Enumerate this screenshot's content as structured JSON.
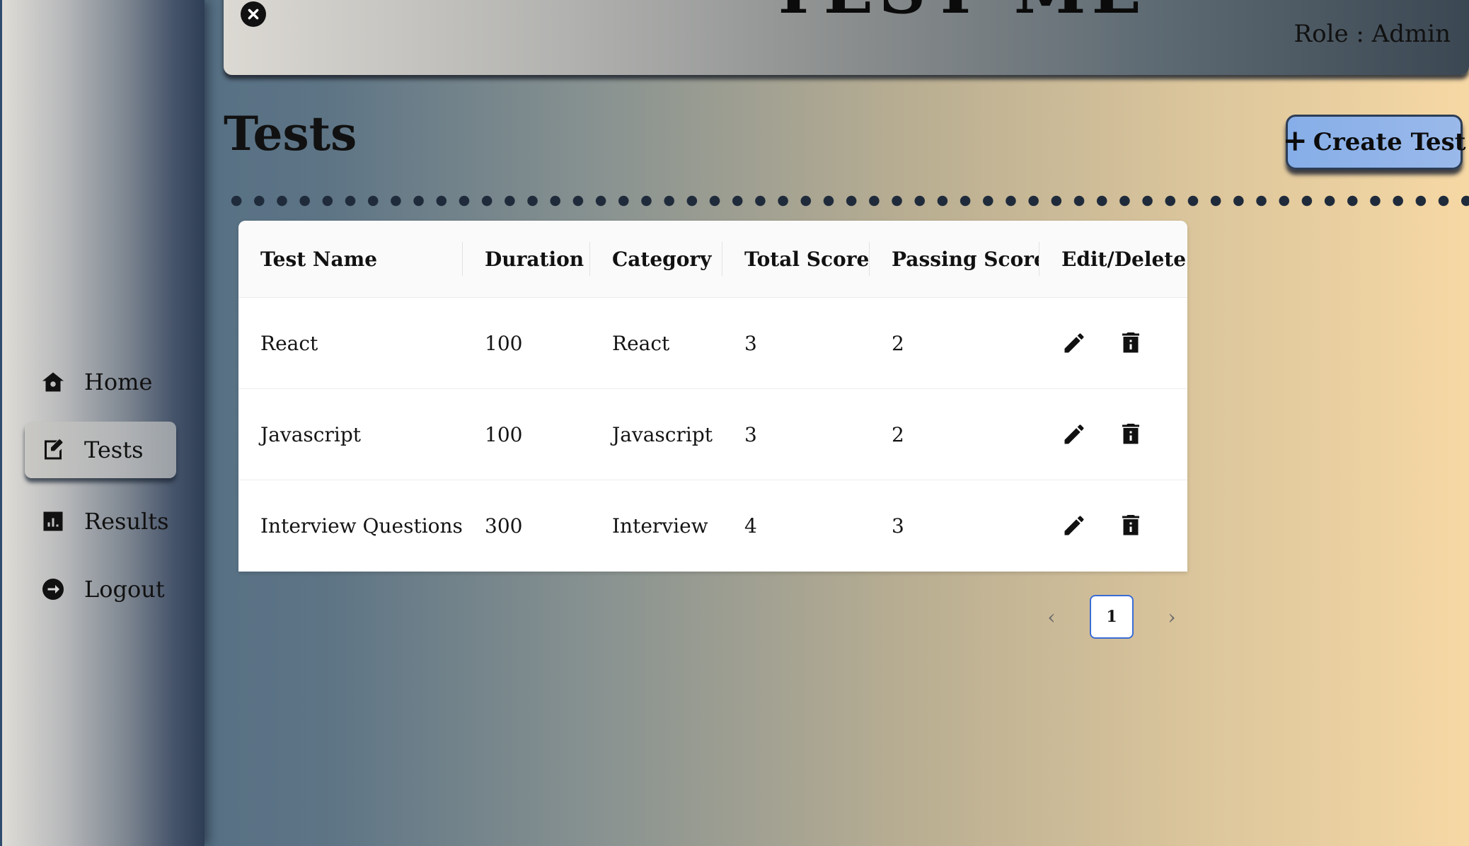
{
  "header": {
    "app_title": "TEST ME",
    "role_text": "Role : Admin"
  },
  "sidebar": {
    "items": [
      {
        "label": "Home",
        "icon": "home-icon"
      },
      {
        "label": "Tests",
        "icon": "edit-note-icon",
        "active": true
      },
      {
        "label": "Results",
        "icon": "bar-chart-icon"
      },
      {
        "label": "Logout",
        "icon": "logout-icon"
      }
    ]
  },
  "main": {
    "title": "Tests",
    "create_button": "Create Test",
    "table": {
      "columns": [
        "Test Name",
        "Duration",
        "Category",
        "Total Score",
        "Passing Score",
        "Edit/Delete"
      ],
      "rows": [
        [
          "React",
          "100",
          "React",
          "3",
          "2"
        ],
        [
          "Javascript",
          "100",
          "Javascript",
          "3",
          "2"
        ],
        [
          "Interview Questions",
          "300",
          "Interview",
          "4",
          "3"
        ]
      ]
    },
    "pagination": {
      "current_page": "1"
    }
  },
  "colors": {
    "accent_button": "#8fb3e9",
    "pagination_border": "#3a6bd6"
  }
}
